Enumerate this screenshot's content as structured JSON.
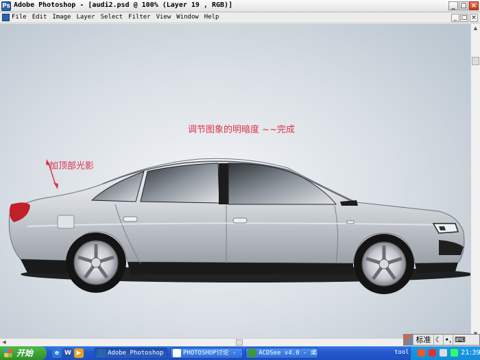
{
  "window": {
    "title": "Adobe Photoshop - [audi2.psd @ 100% (Layer 19 , RGB)]",
    "app_icon": "photoshop-icon",
    "controls": [
      "_",
      "□",
      "×"
    ]
  },
  "menubar": {
    "items": [
      "File",
      "Edit",
      "Image",
      "Layer",
      "Select",
      "Filter",
      "View",
      "Window",
      "Help"
    ],
    "doc_controls": [
      "_",
      "□",
      "×"
    ]
  },
  "canvas": {
    "annotation_main": "调节图象的明暗度  ~~完成",
    "annotation_roof": "加顶部光影",
    "annotation_color": "#e0304a",
    "subject": "silver-sedan-illustration"
  },
  "ime": {
    "mode_label": "标准",
    "icons": [
      "ime-logo-icon",
      "moon-icon",
      "punctuation-icon",
      "keyboard-icon"
    ]
  },
  "taskbar": {
    "start_label": "开始",
    "quick_launch": [
      "ie-icon",
      "word-icon",
      "media-icon"
    ],
    "tasks": [
      {
        "label": "Adobe Photoshop ...",
        "icon": "photoshop-icon",
        "active": true
      },
      {
        "label": "PHOTOSHOP讨论 - ...",
        "icon": "browser-icon",
        "active": false
      },
      {
        "label": "ACDSee v4.0 - 桌面",
        "icon": "acdsee-icon",
        "active": false
      }
    ],
    "tray_label": "tool",
    "clock": "21:39"
  },
  "colors": {
    "taskbar_blue": "#2358cc",
    "start_green": "#3c9f36",
    "canvas_bg": "#d9dfe5"
  }
}
